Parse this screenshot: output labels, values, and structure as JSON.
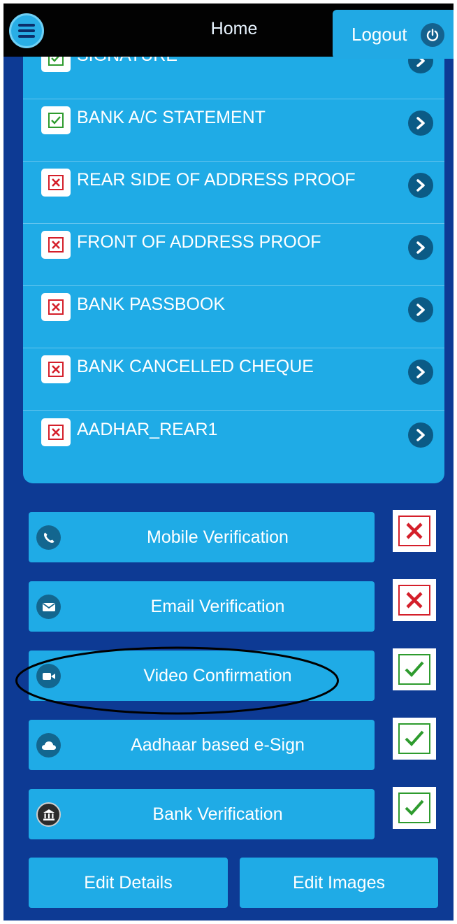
{
  "header": {
    "title": "Home",
    "logout_label": "Logout",
    "menu_icon": "hamburger-menu-icon",
    "logout_icon": "power-icon"
  },
  "documents": [
    {
      "label": "SIGNATURE",
      "status": "ok"
    },
    {
      "label": "BANK A/C STATEMENT",
      "status": "ok"
    },
    {
      "label": "REAR SIDE OF ADDRESS PROOF",
      "status": "missing"
    },
    {
      "label": "FRONT OF ADDRESS PROOF",
      "status": "missing"
    },
    {
      "label": "BANK PASSBOOK",
      "status": "missing"
    },
    {
      "label": "BANK CANCELLED CHEQUE",
      "status": "missing"
    },
    {
      "label": "AADHAR_REAR1",
      "status": "missing"
    }
  ],
  "verifications": [
    {
      "label": "Mobile Verification",
      "icon": "phone-icon",
      "status": "missing"
    },
    {
      "label": "Email Verification",
      "icon": "envelope-icon",
      "status": "missing"
    },
    {
      "label": "Video Confirmation",
      "icon": "video-camera-icon",
      "status": "ok"
    },
    {
      "label": "Aadhaar based e-Sign",
      "icon": "cloud-icon",
      "status": "ok"
    },
    {
      "label": "Bank Verification",
      "icon": "bank-icon",
      "status": "ok"
    }
  ],
  "actions": {
    "edit_details_label": "Edit Details",
    "edit_images_label": "Edit Images"
  },
  "colors": {
    "background": "#0d3a94",
    "header": "#020202",
    "button": "#1fabe6",
    "ok": "#2e9b2e",
    "missing": "#d41f2a"
  }
}
